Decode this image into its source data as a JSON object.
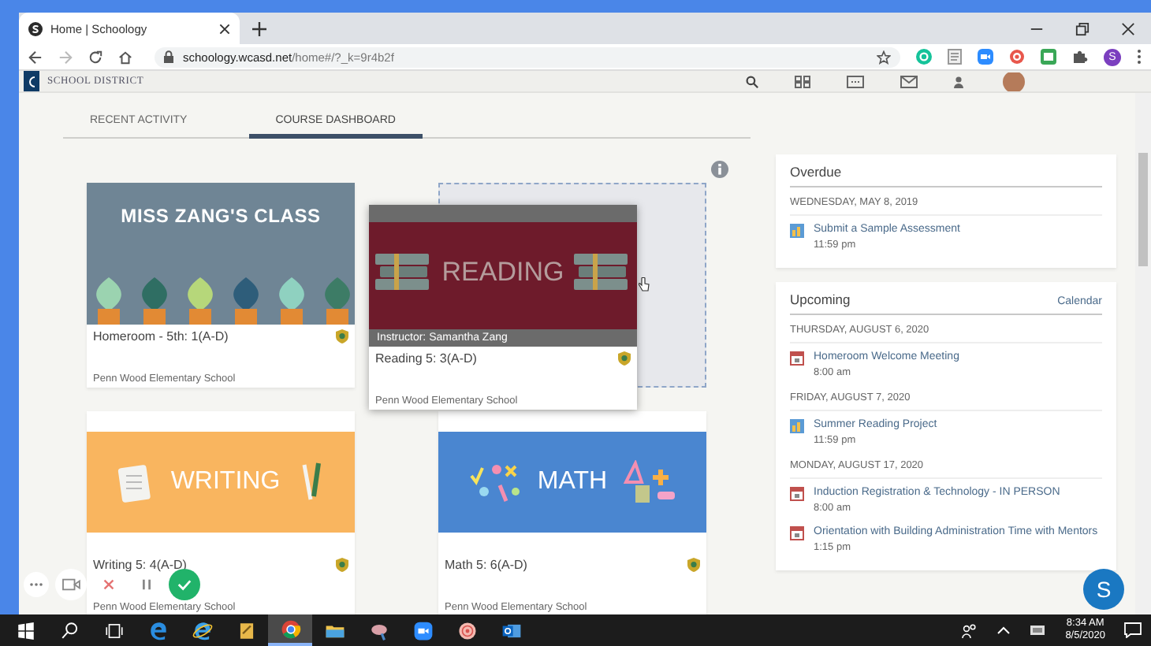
{
  "browser": {
    "tab_title": "Home | Schoology",
    "url_host": "schoology.wcasd.net",
    "url_path": "/home#/?_k=9r4b2f",
    "profile_initial": "S"
  },
  "site_header": {
    "district": "SCHOOL DISTRICT"
  },
  "tabs": [
    {
      "label": "RECENT ACTIVITY",
      "selected": false
    },
    {
      "label": "COURSE DASHBOARD",
      "selected": true
    }
  ],
  "courses": [
    {
      "kind": "plants",
      "banner": "MISS ZANG'S CLASS",
      "title": "Homeroom - 5th: 1(A-D)",
      "school": "Penn Wood Elementary School",
      "dragging": false
    },
    {
      "kind": "books",
      "banner": "READING",
      "instructor": "Instructor: Samantha Zang",
      "title": "Reading 5: 3(A-D)",
      "school": "Penn Wood Elementary School",
      "dragging": true
    },
    {
      "kind": "writing",
      "banner": "WRITING",
      "title": "Writing 5: 4(A-D)",
      "school": "Penn Wood Elementary School",
      "dragging": false
    },
    {
      "kind": "math",
      "banner": "MATH",
      "title": "Math 5: 6(A-D)",
      "school": "Penn Wood Elementary School",
      "dragging": false
    }
  ],
  "overdue": {
    "title": "Overdue",
    "groups": [
      {
        "date": "WEDNESDAY, MAY 8, 2019",
        "items": [
          {
            "kind": "assignment",
            "title": "Submit a Sample Assessment",
            "time": "11:59 pm"
          }
        ]
      }
    ]
  },
  "upcoming": {
    "title": "Upcoming",
    "link": "Calendar",
    "groups": [
      {
        "date": "THURSDAY, AUGUST 6, 2020",
        "items": [
          {
            "kind": "event",
            "title": "Homeroom Welcome Meeting",
            "time": "8:00 am"
          }
        ]
      },
      {
        "date": "FRIDAY, AUGUST 7, 2020",
        "items": [
          {
            "kind": "assignment",
            "title": "Summer Reading Project",
            "time": "11:59 pm"
          }
        ]
      },
      {
        "date": "MONDAY, AUGUST 17, 2020",
        "items": [
          {
            "kind": "event",
            "title": "Induction Registration & Technology - IN PERSON",
            "time": "8:00 am"
          },
          {
            "kind": "event",
            "title": "Orientation with Building Administration Time with Mentors",
            "time": "1:15 pm"
          }
        ]
      }
    ]
  },
  "chat": {
    "initial": "S"
  },
  "taskbar": {
    "apps": [
      {
        "kind": "start",
        "active": false
      },
      {
        "kind": "search",
        "active": false
      },
      {
        "kind": "taskview",
        "active": false
      },
      {
        "kind": "edge",
        "active": false
      },
      {
        "kind": "ie",
        "active": false
      },
      {
        "kind": "notes",
        "active": false
      },
      {
        "kind": "chrome",
        "active": true
      },
      {
        "kind": "files",
        "active": false
      },
      {
        "kind": "viewer",
        "active": false
      },
      {
        "kind": "zoom",
        "active": false
      },
      {
        "kind": "app",
        "active": false
      },
      {
        "kind": "outlook",
        "active": false
      }
    ],
    "time": "8:34 AM",
    "date": "8/5/2020"
  }
}
